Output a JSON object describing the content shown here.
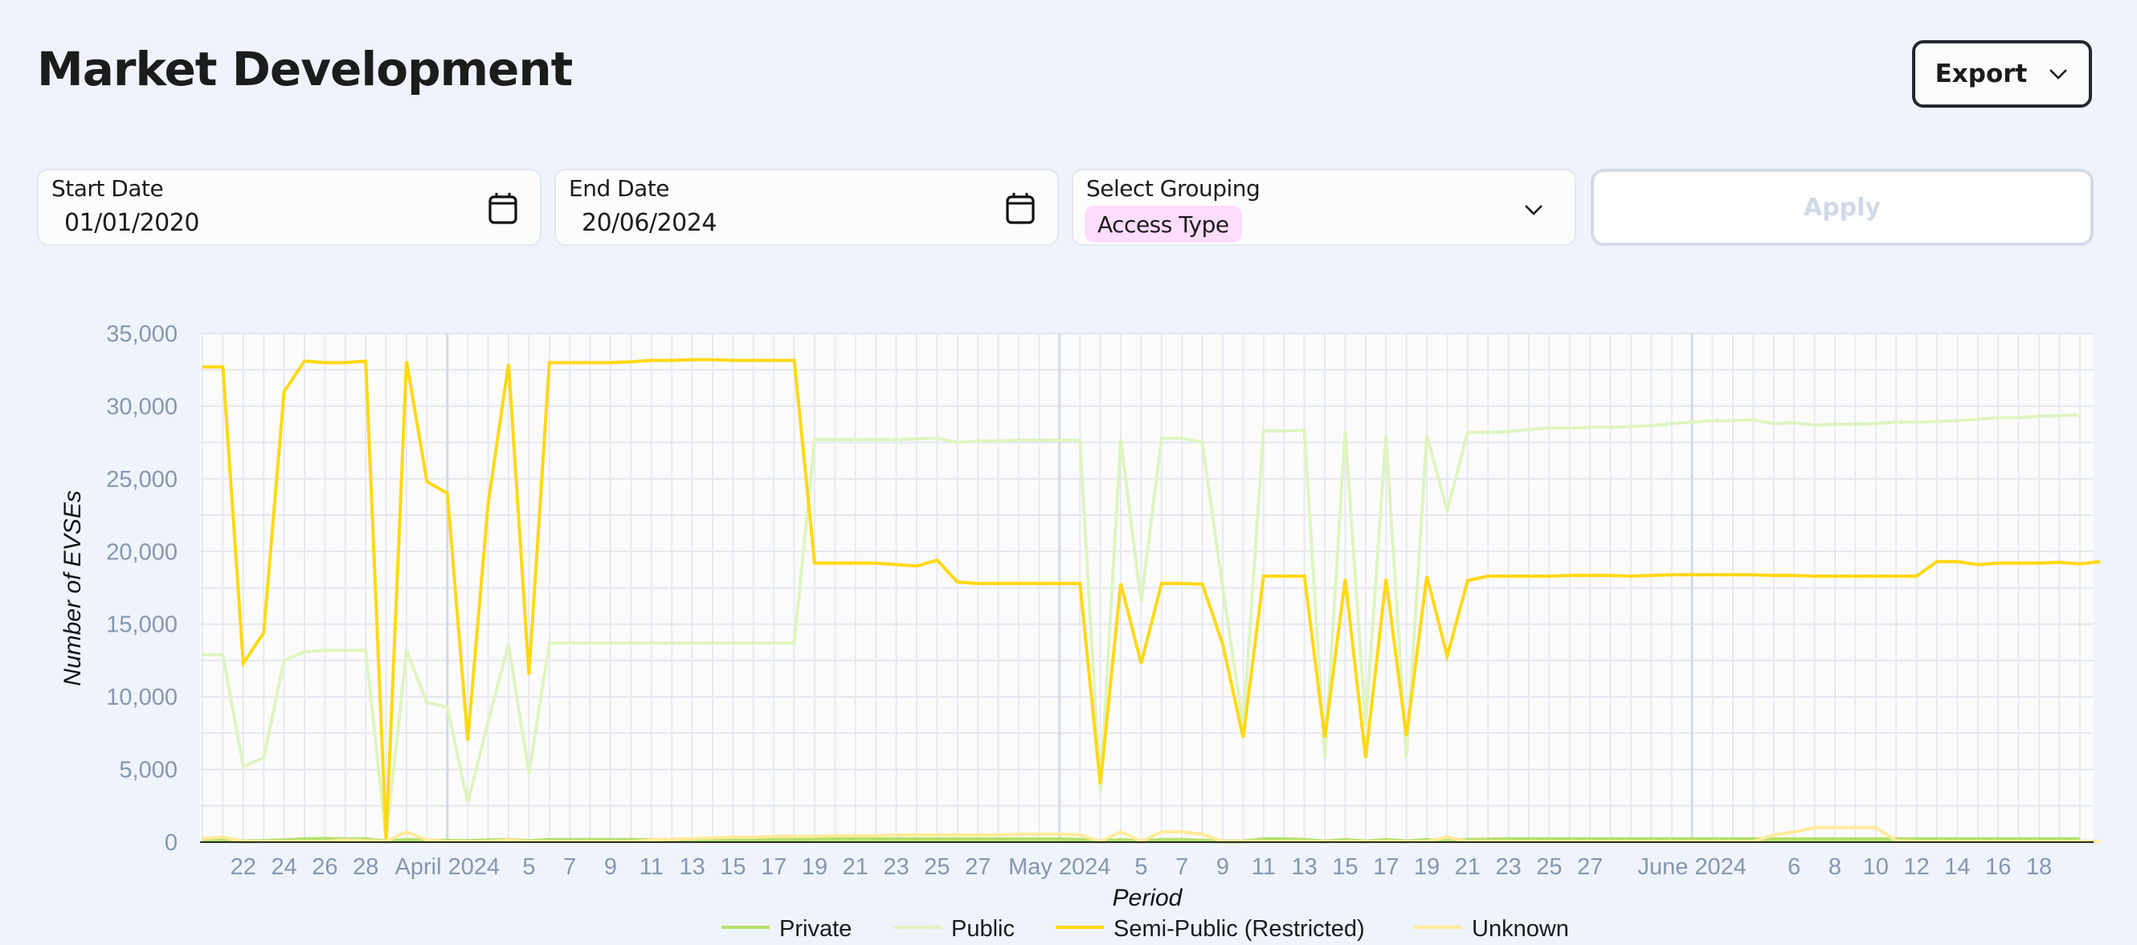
{
  "header": {
    "title": "Market Development",
    "export_label": "Export",
    "export_icon": "chevron-down-icon"
  },
  "filters": {
    "start_date": {
      "label": "Start Date",
      "value": "01/01/2020",
      "icon": "calendar-icon"
    },
    "end_date": {
      "label": "End Date",
      "value": "20/06/2024",
      "icon": "calendar-icon"
    },
    "grouping": {
      "label": "Select Grouping",
      "selected": "Access Type",
      "chip_color": "#fedcfb",
      "icon": "chevron-down-icon"
    },
    "apply_label": "Apply"
  },
  "chart_data": {
    "type": "line",
    "title": "",
    "xlabel": "Period",
    "ylabel": "Number of EVSEs",
    "ylim": [
      0,
      35000
    ],
    "y_ticks": [
      "0",
      "5,000",
      "10,000",
      "15,000",
      "20,000",
      "25,000",
      "30,000",
      "35,000"
    ],
    "y_tick_values": [
      0,
      5000,
      10000,
      15000,
      20000,
      25000,
      30000,
      35000
    ],
    "x_start": "2024-03-20",
    "x_end": "2024-06-20",
    "x_interval": "daily",
    "x_ticks": [
      {
        "day": 2,
        "label": "22"
      },
      {
        "day": 4,
        "label": "24"
      },
      {
        "day": 6,
        "label": "26"
      },
      {
        "day": 8,
        "label": "28"
      },
      {
        "day": 12,
        "label": "April 2024"
      },
      {
        "day": 16,
        "label": "5"
      },
      {
        "day": 18,
        "label": "7"
      },
      {
        "day": 20,
        "label": "9"
      },
      {
        "day": 22,
        "label": "11"
      },
      {
        "day": 24,
        "label": "13"
      },
      {
        "day": 26,
        "label": "15"
      },
      {
        "day": 28,
        "label": "17"
      },
      {
        "day": 30,
        "label": "19"
      },
      {
        "day": 32,
        "label": "21"
      },
      {
        "day": 34,
        "label": "23"
      },
      {
        "day": 36,
        "label": "25"
      },
      {
        "day": 38,
        "label": "27"
      },
      {
        "day": 42,
        "label": "May 2024"
      },
      {
        "day": 46,
        "label": "5"
      },
      {
        "day": 48,
        "label": "7"
      },
      {
        "day": 50,
        "label": "9"
      },
      {
        "day": 52,
        "label": "11"
      },
      {
        "day": 54,
        "label": "13"
      },
      {
        "day": 56,
        "label": "15"
      },
      {
        "day": 58,
        "label": "17"
      },
      {
        "day": 60,
        "label": "19"
      },
      {
        "day": 62,
        "label": "21"
      },
      {
        "day": 64,
        "label": "23"
      },
      {
        "day": 66,
        "label": "25"
      },
      {
        "day": 68,
        "label": "27"
      },
      {
        "day": 73,
        "label": "June 2024"
      },
      {
        "day": 78,
        "label": "6"
      },
      {
        "day": 80,
        "label": "8"
      },
      {
        "day": 82,
        "label": "10"
      },
      {
        "day": 84,
        "label": "12"
      },
      {
        "day": 86,
        "label": "14"
      },
      {
        "day": 88,
        "label": "16"
      },
      {
        "day": 90,
        "label": "18"
      }
    ],
    "month_starts": [
      12,
      42,
      73
    ],
    "grid": true,
    "legend_position": "bottom",
    "series": [
      {
        "name": "Private",
        "color": "#b5e26a",
        "values": [
          200,
          150,
          50,
          80,
          120,
          200,
          220,
          200,
          200,
          50,
          150,
          100,
          100,
          80,
          120,
          150,
          80,
          150,
          150,
          150,
          150,
          150,
          150,
          150,
          150,
          150,
          150,
          150,
          150,
          150,
          200,
          200,
          200,
          200,
          200,
          200,
          200,
          200,
          200,
          200,
          200,
          200,
          200,
          150,
          50,
          150,
          50,
          150,
          150,
          100,
          50,
          50,
          200,
          200,
          150,
          50,
          150,
          50,
          150,
          50,
          150,
          100,
          150,
          180,
          200,
          200,
          200,
          200,
          200,
          200,
          200,
          200,
          200,
          200,
          200,
          200,
          200,
          200,
          200,
          200,
          200,
          200,
          200,
          200,
          200,
          200,
          200,
          200,
          200,
          200,
          200,
          200,
          200
        ]
      },
      {
        "name": "Public",
        "color": "#dff4c0",
        "values": [
          12900,
          12900,
          5200,
          5800,
          12500,
          13100,
          13200,
          13200,
          13200,
          200,
          13200,
          9600,
          9300,
          2700,
          8300,
          13600,
          4700,
          13700,
          13700,
          13700,
          13700,
          13700,
          13700,
          13700,
          13700,
          13700,
          13700,
          13700,
          13700,
          13700,
          27700,
          27700,
          27700,
          27700,
          27700,
          27750,
          27800,
          27500,
          27600,
          27600,
          27650,
          27650,
          27650,
          27650,
          3500,
          27700,
          16500,
          27800,
          27800,
          27500,
          17500,
          8000,
          28300,
          28300,
          28350,
          5800,
          28300,
          8000,
          28000,
          5800,
          28000,
          22800,
          28200,
          28200,
          28250,
          28400,
          28500,
          28500,
          28550,
          28550,
          28600,
          28650,
          28800,
          28900,
          29000,
          29000,
          29050,
          28800,
          28850,
          28700,
          28750,
          28750,
          28800,
          28900,
          28900,
          28950,
          29000,
          29100,
          29200,
          29200,
          29300,
          29350,
          29400
        ]
      },
      {
        "name": "Semi-Public (Restricted)",
        "color": "#ffd813",
        "values": [
          32700,
          32700,
          12300,
          14400,
          31000,
          33100,
          33000,
          33000,
          33100,
          200,
          33100,
          24800,
          24000,
          7000,
          23300,
          32900,
          11500,
          33000,
          33000,
          33000,
          33000,
          33050,
          33150,
          33150,
          33200,
          33200,
          33150,
          33150,
          33150,
          33150,
          19200,
          19200,
          19200,
          19200,
          19100,
          19000,
          19400,
          17900,
          17800,
          17800,
          17800,
          17800,
          17800,
          17800,
          4000,
          17800,
          12300,
          17800,
          17800,
          17750,
          13600,
          7200,
          18300,
          18300,
          18300,
          7200,
          18100,
          5800,
          18100,
          7300,
          18300,
          12800,
          18000,
          18300,
          18300,
          18300,
          18300,
          18350,
          18350,
          18350,
          18300,
          18350,
          18400,
          18400,
          18400,
          18400,
          18400,
          18350,
          18350,
          18300,
          18300,
          18300,
          18300,
          18300,
          18300,
          19300,
          19300,
          19100,
          19200,
          19200,
          19200,
          19250,
          19150,
          19300
        ]
      },
      {
        "name": "Unknown",
        "color": "#ffeb99",
        "values": [
          250,
          350,
          50,
          50,
          50,
          50,
          50,
          150,
          100,
          50,
          700,
          150,
          50,
          50,
          50,
          150,
          50,
          50,
          50,
          50,
          50,
          50,
          150,
          200,
          250,
          300,
          350,
          350,
          400,
          400,
          400,
          450,
          450,
          450,
          500,
          500,
          500,
          500,
          500,
          500,
          550,
          550,
          550,
          500,
          50,
          700,
          50,
          700,
          700,
          550,
          50,
          50,
          50,
          50,
          50,
          50,
          50,
          50,
          50,
          50,
          50,
          350,
          50,
          50,
          50,
          50,
          50,
          50,
          50,
          50,
          50,
          50,
          50,
          50,
          50,
          50,
          50,
          500,
          700,
          1000,
          1000,
          1000,
          1000,
          100,
          50,
          50,
          50,
          50,
          50,
          50,
          50,
          50,
          50,
          50
        ]
      }
    ]
  }
}
